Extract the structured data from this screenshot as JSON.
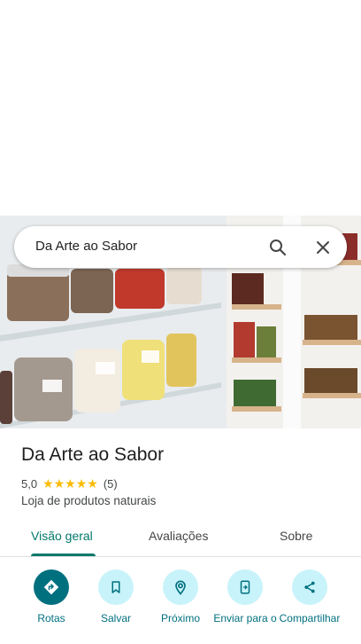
{
  "search": {
    "query": "Da Arte ao Sabor"
  },
  "place": {
    "title": "Da Arte ao Sabor",
    "rating": "5,0",
    "stars": "★★★★★",
    "review_count": "(5)",
    "category": "Loja de produtos naturais"
  },
  "tabs": [
    {
      "label": "Visão geral",
      "selected": true
    },
    {
      "label": "Avaliações",
      "selected": false
    },
    {
      "label": "Sobre",
      "selected": false
    }
  ],
  "actions": [
    {
      "label": "Rotas",
      "icon": "directions-icon"
    },
    {
      "label": "Salvar",
      "icon": "bookmark-icon"
    },
    {
      "label": "Próximo",
      "icon": "nearby-icon"
    },
    {
      "label": "Enviar para o",
      "icon": "send-to-phone-icon"
    },
    {
      "label": "Compartilhar",
      "icon": "share-icon"
    }
  ],
  "colors": {
    "accent": "#00796b",
    "action_primary": "#00707f",
    "action_secondary_bg": "#c8f3fa",
    "star": "#fbbc04"
  }
}
